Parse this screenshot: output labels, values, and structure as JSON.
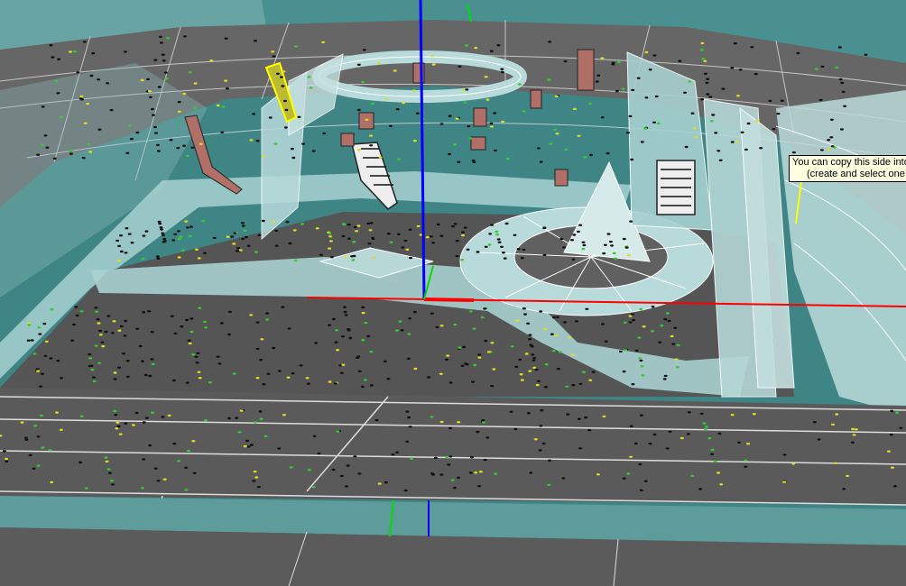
{
  "window": {
    "view": "3D perspective viewport"
  },
  "tooltip": {
    "line1": "You can copy this side into",
    "line2": "(create and select one o"
  },
  "colors": {
    "floor": "#5e5e5e",
    "floor_dark": "#4f4f4f",
    "glass": "#a8d0d0",
    "teal_band": "#5e9c9c",
    "sky_teal": "#3f8585",
    "axis_z": "#0000ff",
    "axis_x": "#ff0000",
    "axis_y": "#00cc00",
    "selected": "#ffff00",
    "speaker": "#b07068"
  },
  "icons": [
    "z-axis-line",
    "x-axis-line",
    "y-axis-line"
  ]
}
